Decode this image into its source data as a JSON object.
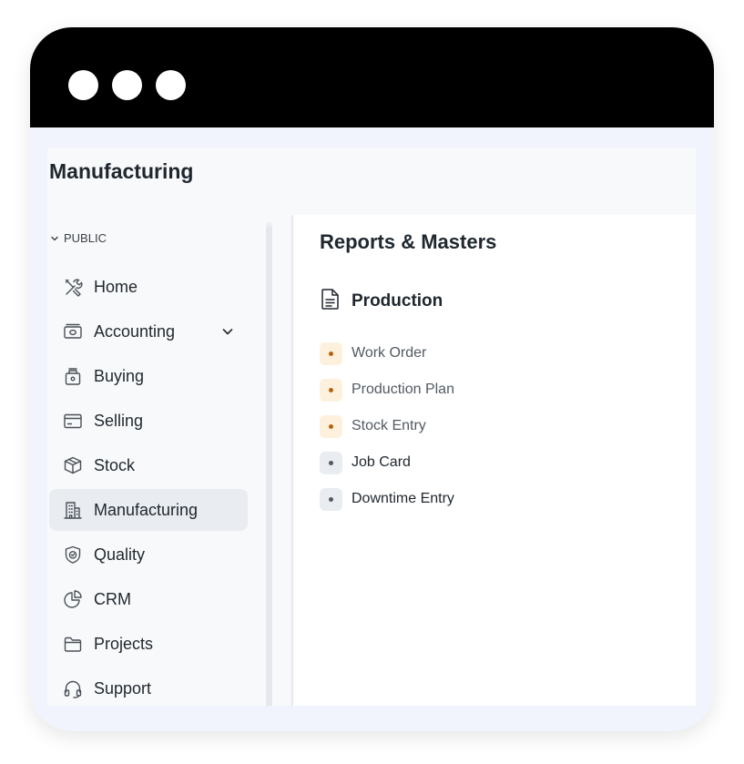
{
  "page": {
    "title": "Manufacturing"
  },
  "sidebar": {
    "section": "PUBLIC",
    "items": [
      {
        "label": "Home",
        "icon": "tools-icon"
      },
      {
        "label": "Accounting",
        "icon": "money-icon",
        "expandable": true
      },
      {
        "label": "Buying",
        "icon": "bag-icon"
      },
      {
        "label": "Selling",
        "icon": "card-icon"
      },
      {
        "label": "Stock",
        "icon": "box-icon"
      },
      {
        "label": "Manufacturing",
        "icon": "building-icon",
        "active": true
      },
      {
        "label": "Quality",
        "icon": "shield-check-icon"
      },
      {
        "label": "CRM",
        "icon": "pie-chart-icon"
      },
      {
        "label": "Projects",
        "icon": "folder-icon"
      },
      {
        "label": "Support",
        "icon": "headphones-icon"
      }
    ]
  },
  "main": {
    "title": "Reports & Masters",
    "card": {
      "title": "Production",
      "icon": "document-icon",
      "links": [
        {
          "label": "Work Order",
          "style": "warning"
        },
        {
          "label": "Production Plan",
          "style": "warning"
        },
        {
          "label": "Stock Entry",
          "style": "warning"
        },
        {
          "label": "Job Card",
          "style": "default"
        },
        {
          "label": "Downtime Entry",
          "style": "default"
        }
      ]
    }
  },
  "colors": {
    "titlebar": "#000000",
    "window_bg": "#f1f4fc",
    "text": "#1f272e",
    "muted_text": "#525a62",
    "active_bg": "#e9ecf1",
    "warning_bg": "#fdf1dd",
    "warning_dot": "#b7640f",
    "default_bg": "#e9ecf1",
    "default_dot": "#525a62"
  }
}
